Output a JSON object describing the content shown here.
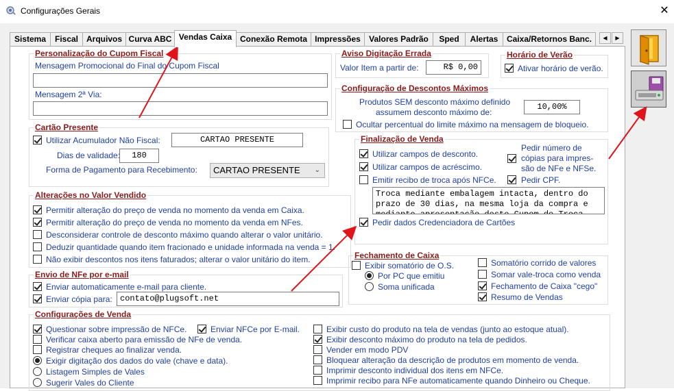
{
  "window": {
    "title": "Configurações Gerais",
    "close_label": "✕"
  },
  "tabs": [
    "Sistema",
    "Fiscal",
    "Arquivos",
    "Curva ABC",
    "Vendas Caixa",
    "Conexão Remota",
    "Impressões",
    "Valores Padrão",
    "Sped",
    "Alertas",
    "Caixa/Retornos Banc."
  ],
  "tab_scroll": {
    "left": "◀",
    "right": "▶"
  },
  "cupom": {
    "title": "Personalização do Cupom Fiscal",
    "msg_final_label": "Mensagem Promocional do Final do Cupom Fiscal",
    "msg_final_value": "",
    "msg_2via_label": "Mensagem 2ª Via:",
    "msg_2via_value": ""
  },
  "cartao": {
    "title": "Cartão Presente",
    "acumulador_label": "Utilizar Acumulador Não Fiscal:",
    "acumulador_value": "CARTAO PRESENTE",
    "dias_label": "Dias de validade:",
    "dias_value": "180",
    "forma_label": "Forma de Pagamento para Recebimento:",
    "forma_value": "CARTAO PRESENTE"
  },
  "alteracoes": {
    "title": "Alterações no Valor Vendido",
    "items": [
      "Permitir alteração do preço de venda no momento da venda em Caixa.",
      "Permitir alteração do preço de venda no momento da venda em NFes.",
      "Desconsiderar controle de desconto máximo quando alterar o valor unitário.",
      "Deduzir quantidade quando item fracionado e unidade informada na venda = 1.",
      "Não exibir descontos nos itens faturados; alterar o valor unitário do item."
    ]
  },
  "envio": {
    "title": "Envio de NFe por e-mail",
    "auto_label": "Enviar automaticamente e-mail para cliente.",
    "copia_label": "Enviar cópia para:",
    "copia_value": "contato@plugsoft.net"
  },
  "config_venda": {
    "title": "Configurações de Venda",
    "left": [
      "Questionar sobre impressão de NFCe.",
      "Verificar caixa aberto para emissão de NFe de venda.",
      "Registrar cheques ao finalizar venda.",
      "Exigir digitação dos dados do vale (chave e data).",
      "Listagem Simples de Vales",
      "Sugerir Vales do Cliente"
    ],
    "enviar_nfce": "Enviar NFCe por E-mail.",
    "right": [
      "Exibir custo do produto na tela de vendas (junto ao estoque atual).",
      "Exibir desconto máximo do produto na tela de pedidos.",
      "Vender em modo PDV",
      "Bloquear alteração da descrição de produtos em momento de venda.",
      "Imprimir desconto individual dos itens em NFCe.",
      "Imprimir recibo para NFe automaticamente quando Dinheiro ou Cheque."
    ]
  },
  "aviso": {
    "title": "Aviso Digitação Errada",
    "label": "Valor Item a partir de:",
    "value": "R$ 0,00"
  },
  "horario": {
    "title": "Horário de Verão",
    "label": "Ativar horário de verão."
  },
  "descontos": {
    "title": "Configuração de Descontos Máximos",
    "line1": "Produtos SEM desconto máximo definido",
    "line2": "assumem desconto máximo de:",
    "value": "10,00%",
    "ocultar": "Ocultar percentual do limite máximo na mensagem de bloqueio."
  },
  "finalizacao": {
    "title": "Finalização de Venda",
    "campos_desconto": "Utilizar campos de desconto.",
    "campos_acrescimo": "Utilizar campos de acréscimo.",
    "recibo_troca": "Emitir recibo de troca após NFCe.",
    "copias_line1": "Pedir número de",
    "copias_line2": "cópias para impres-",
    "copias_line3": "são de NFe e NFSe.",
    "pedir_cpf": "Pedir CPF.",
    "memo": "Troca mediante embalagem intacta, dentro do prazo de 30 dias, na mesma loja da compra e mediante apresentação deste Cupom de Troca.",
    "credenciadora": "Pedir dados Credenciadora de Cartões"
  },
  "fechamento": {
    "title": "Fechamento de Caixa",
    "somatorio_os": "Exibir somatório de O.S.",
    "por_pc": "Por PC que emitiu",
    "unificada": "Soma unificada",
    "somatorio_corrido": "Somatório corrido de valores",
    "somar_vale": "Somar vale-troca como venda",
    "cego": "Fechamento de Caixa \"cego\"",
    "resumo": "Resumo de Vendas"
  },
  "colors": {
    "label_blue": "#1f3fa8",
    "group_title": "#8b1a1a",
    "arrow_red": "#e0151b"
  }
}
